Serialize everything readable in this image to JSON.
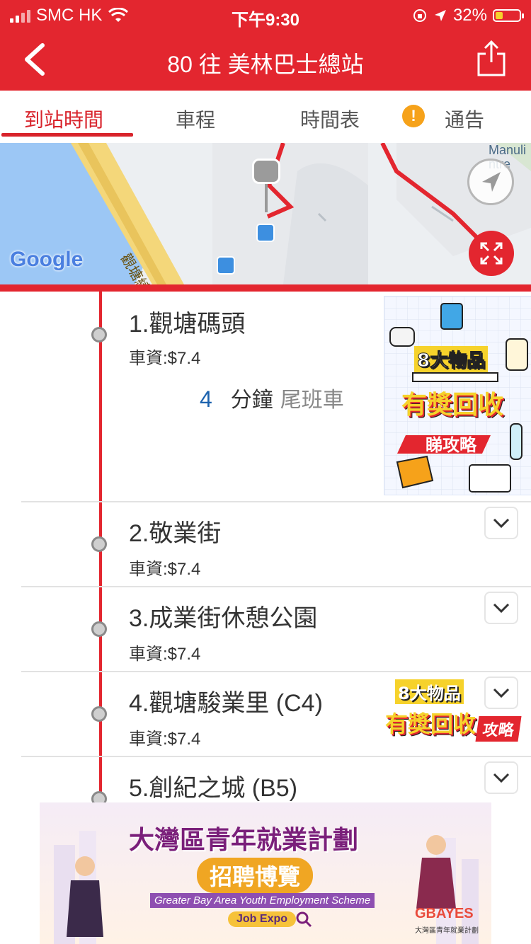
{
  "status_bar": {
    "carrier": "SMC HK",
    "time": "下午9:30",
    "battery": "32%",
    "battery_level": 0.32
  },
  "header": {
    "title": "80 往 美林巴士總站"
  },
  "tabs": [
    {
      "label": "到站時間",
      "active": true
    },
    {
      "label": "車程",
      "active": false
    },
    {
      "label": "時間表",
      "active": false
    },
    {
      "label": "通告",
      "active": false
    }
  ],
  "notice_badge": "!",
  "map": {
    "google_logo": "Google",
    "road_label": "觀塘繞",
    "place_label_1": "Manuli",
    "place_label_2": "ntre"
  },
  "stops": [
    {
      "name": "1.觀塘碼頭",
      "fare": "車資:$7.4",
      "eta_minutes": "4",
      "eta_unit": "分鐘",
      "eta_note": "尾班車"
    },
    {
      "name": "2.敬業街",
      "fare": "車資:$7.4"
    },
    {
      "name": "3.成業街休憩公園",
      "fare": "車資:$7.4"
    },
    {
      "name": "4.觀塘駿業里 (C4)",
      "fare": "車資:$7.4"
    },
    {
      "name": "5.創紀之城 (B5)",
      "fare": ""
    }
  ],
  "promo_large": {
    "line1": "8大物品",
    "line2": "有獎回收",
    "line3": "睇攻略"
  },
  "promo_small": {
    "line1": "8大物品",
    "line2": "有獎回收",
    "line3": "攻略"
  },
  "banner": {
    "title": "大灣區青年就業計劃",
    "subtitle": "招聘博覽",
    "english": "Greater Bay Area Youth Employment Scheme",
    "job_expo": "Job Expo",
    "logo_text": "GBAYES",
    "logo_caption": "大灣區青年就業計劃"
  },
  "colors": {
    "brand_red": "#e3262f",
    "eta_blue": "#1c62ae",
    "notice_orange": "#f6a21a"
  }
}
